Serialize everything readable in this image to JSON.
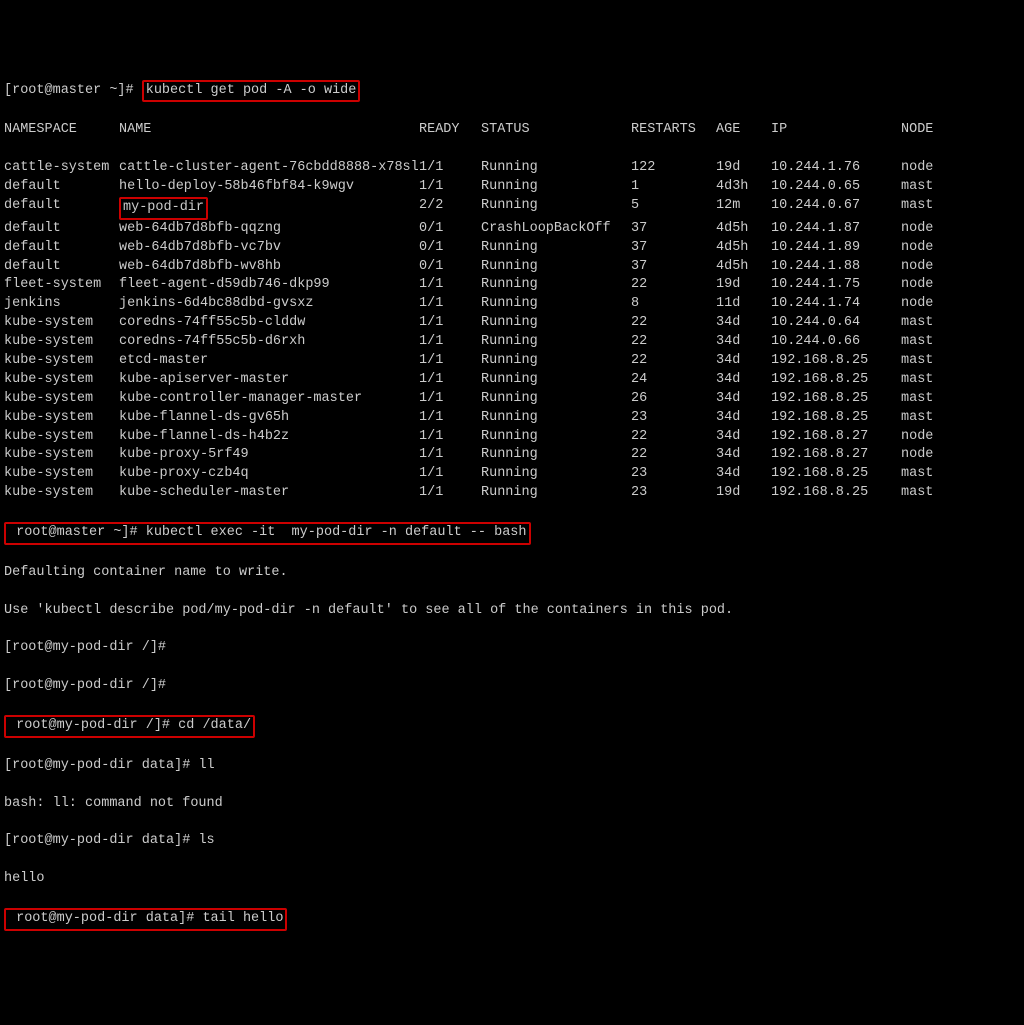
{
  "prompt1_prefix": "[root@master ~]# ",
  "cmd1": "kubectl get pod -A -o wide",
  "headers": {
    "namespace": "NAMESPACE",
    "name": "NAME",
    "ready": "READY",
    "status": "STATUS",
    "restarts": "RESTARTS",
    "age": "AGE",
    "ip": "IP",
    "node": "NODE"
  },
  "rows": [
    {
      "ns": "cattle-system",
      "name": "cattle-cluster-agent-76cbdd8888-x78sl",
      "ready": "1/1",
      "status": "Running",
      "restarts": "122",
      "age": "19d",
      "ip": "10.244.1.76",
      "node": "node"
    },
    {
      "ns": "default",
      "name": "hello-deploy-58b46fbf84-k9wgv",
      "ready": "1/1",
      "status": "Running",
      "restarts": "1",
      "age": "4d3h",
      "ip": "10.244.0.65",
      "node": "mast"
    },
    {
      "ns": "default",
      "name": "my-pod-dir",
      "ready": "2/2",
      "status": "Running",
      "restarts": "5",
      "age": "12m",
      "ip": "10.244.0.67",
      "node": "mast",
      "name_hl": true
    },
    {
      "ns": "default",
      "name": "web-64db7d8bfb-qqzng",
      "ready": "0/1",
      "status": "CrashLoopBackOff",
      "restarts": "37",
      "age": "4d5h",
      "ip": "10.244.1.87",
      "node": "node"
    },
    {
      "ns": "default",
      "name": "web-64db7d8bfb-vc7bv",
      "ready": "0/1",
      "status": "Running",
      "restarts": "37",
      "age": "4d5h",
      "ip": "10.244.1.89",
      "node": "node"
    },
    {
      "ns": "default",
      "name": "web-64db7d8bfb-wv8hb",
      "ready": "0/1",
      "status": "Running",
      "restarts": "37",
      "age": "4d5h",
      "ip": "10.244.1.88",
      "node": "node"
    },
    {
      "ns": "fleet-system",
      "name": "fleet-agent-d59db746-dkp99",
      "ready": "1/1",
      "status": "Running",
      "restarts": "22",
      "age": "19d",
      "ip": "10.244.1.75",
      "node": "node"
    },
    {
      "ns": "jenkins",
      "name": "jenkins-6d4bc88dbd-gvsxz",
      "ready": "1/1",
      "status": "Running",
      "restarts": "8",
      "age": "11d",
      "ip": "10.244.1.74",
      "node": "node"
    },
    {
      "ns": "kube-system",
      "name": "coredns-74ff55c5b-clddw",
      "ready": "1/1",
      "status": "Running",
      "restarts": "22",
      "age": "34d",
      "ip": "10.244.0.64",
      "node": "mast"
    },
    {
      "ns": "kube-system",
      "name": "coredns-74ff55c5b-d6rxh",
      "ready": "1/1",
      "status": "Running",
      "restarts": "22",
      "age": "34d",
      "ip": "10.244.0.66",
      "node": "mast"
    },
    {
      "ns": "kube-system",
      "name": "etcd-master",
      "ready": "1/1",
      "status": "Running",
      "restarts": "22",
      "age": "34d",
      "ip": "192.168.8.25",
      "node": "mast"
    },
    {
      "ns": "kube-system",
      "name": "kube-apiserver-master",
      "ready": "1/1",
      "status": "Running",
      "restarts": "24",
      "age": "34d",
      "ip": "192.168.8.25",
      "node": "mast"
    },
    {
      "ns": "kube-system",
      "name": "kube-controller-manager-master",
      "ready": "1/1",
      "status": "Running",
      "restarts": "26",
      "age": "34d",
      "ip": "192.168.8.25",
      "node": "mast"
    },
    {
      "ns": "kube-system",
      "name": "kube-flannel-ds-gv65h",
      "ready": "1/1",
      "status": "Running",
      "restarts": "23",
      "age": "34d",
      "ip": "192.168.8.25",
      "node": "mast"
    },
    {
      "ns": "kube-system",
      "name": "kube-flannel-ds-h4b2z",
      "ready": "1/1",
      "status": "Running",
      "restarts": "22",
      "age": "34d",
      "ip": "192.168.8.27",
      "node": "node"
    },
    {
      "ns": "kube-system",
      "name": "kube-proxy-5rf49",
      "ready": "1/1",
      "status": "Running",
      "restarts": "22",
      "age": "34d",
      "ip": "192.168.8.27",
      "node": "node"
    },
    {
      "ns": "kube-system",
      "name": "kube-proxy-czb4q",
      "ready": "1/1",
      "status": "Running",
      "restarts": "23",
      "age": "34d",
      "ip": "192.168.8.25",
      "node": "mast"
    },
    {
      "ns": "kube-system",
      "name": "kube-scheduler-master",
      "ready": "1/1",
      "status": "Running",
      "restarts": "23",
      "age": "19d",
      "ip": "192.168.8.25",
      "node": "mast"
    }
  ],
  "exec_prompt_prefix": " root@master ~]# ",
  "exec_cmd": "kubectl exec -it  my-pod-dir -n default -- bash",
  "line_defaulting": "Defaulting container name to write.",
  "line_use": "Use 'kubectl describe pod/my-pod-dir -n default' to see all of the containers in this pod.",
  "pod_prompt1": "[root@my-pod-dir /]#",
  "pod_prompt2": "[root@my-pod-dir /]#",
  "cd_line_prompt": " root@my-pod-dir /]# ",
  "cd_cmd": "cd /data/",
  "ll_prompt": "[root@my-pod-dir data]# ",
  "ll_cmd": "ll",
  "bash_err": "bash: ll: command not found",
  "ls_prompt": "[root@my-pod-dir data]# ",
  "ls_cmd": "ls",
  "hello": "hello",
  "tail_prompt": " root@my-pod-dir data]# ",
  "tail_cmd": "tail hello"
}
